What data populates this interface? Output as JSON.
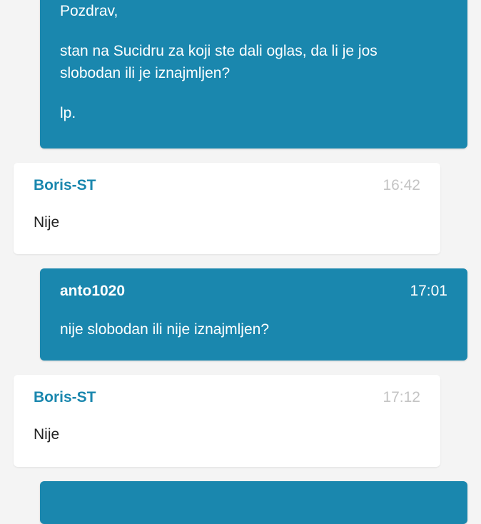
{
  "messages": [
    {
      "type": "sent",
      "paragraphs": [
        "Pozdrav,",
        "stan na Sucidru za koji ste dali oglas, da li je jos slobodan ili je iznajmljen?",
        "lp."
      ]
    },
    {
      "type": "received",
      "author": "Boris-ST",
      "time": "16:42",
      "text": "Nije"
    },
    {
      "type": "sent",
      "author": "anto1020",
      "time": "17:01",
      "text": "nije slobodan ili nije iznajmljen?"
    },
    {
      "type": "received",
      "author": "Boris-ST",
      "time": "17:12",
      "text": "Nije"
    }
  ],
  "colors": {
    "accent": "#1a87ae",
    "background": "#f4f4f4"
  }
}
